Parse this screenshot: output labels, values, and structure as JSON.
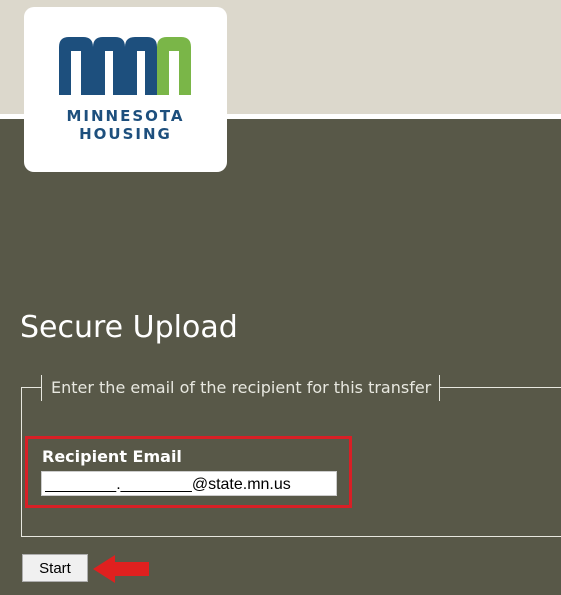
{
  "header": {
    "logo": {
      "line1": "MINNESOTA",
      "line2": "HOUSING",
      "mark_icon": "mn-logo-mark",
      "colors": {
        "blue": "#1d4f7d",
        "green": "#7ab648"
      }
    }
  },
  "main": {
    "title": "Secure Upload",
    "fieldset": {
      "legend": "Enter the email of the recipient for this transfer",
      "recipient_label": "Recipient Email",
      "recipient_value": "________.________@state.mn.us"
    },
    "start_label": "Start",
    "annotation": {
      "highlight_color": "#d81f26",
      "arrow_icon": "red-arrow-icon"
    }
  },
  "colors": {
    "top_band": "#dcd8cc",
    "page_background": "#585848",
    "text_light": "#ffffff",
    "border_light": "#e8e8e0"
  }
}
